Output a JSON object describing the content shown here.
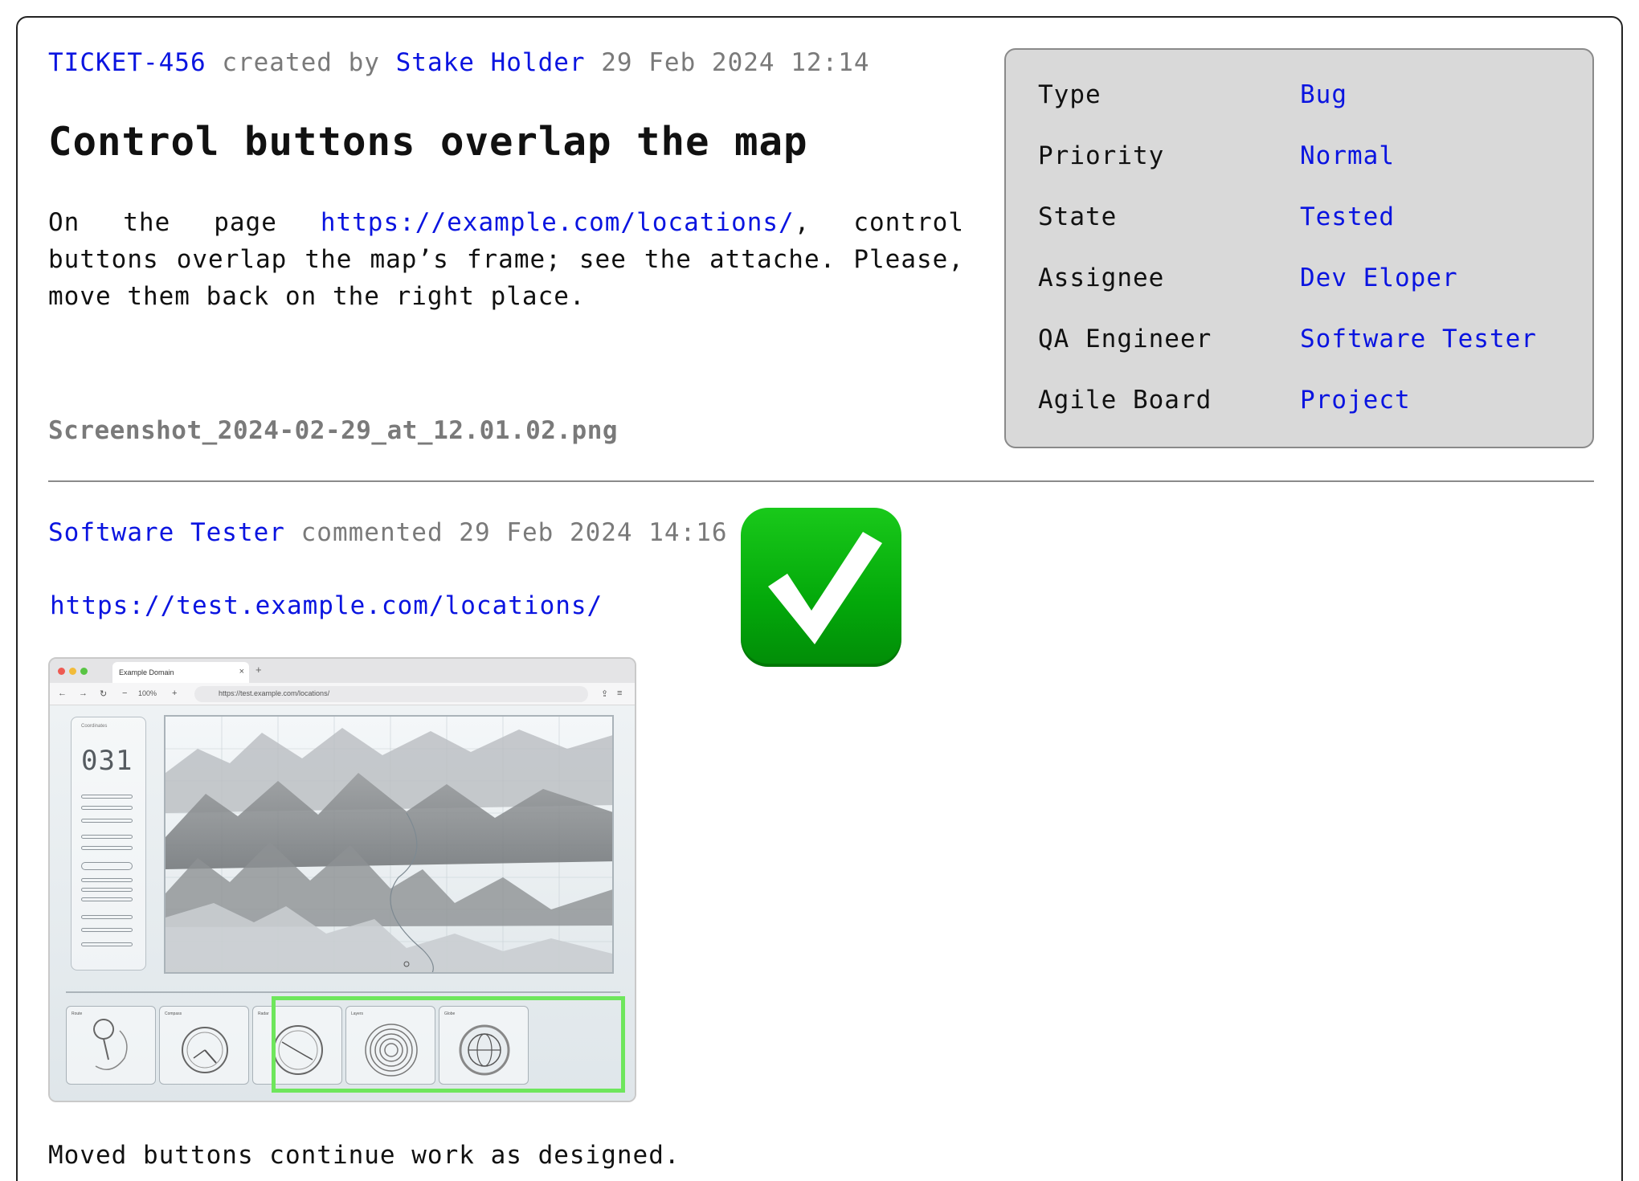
{
  "ticket": {
    "id": "TICKET-456",
    "created_by_text": "created by",
    "author": "Stake Holder",
    "created_at": "29 Feb 2024 12:14",
    "title": "Control buttons overlap the map",
    "description_prefix": "On the page ",
    "description_link": "https://example.com/locations/",
    "description_suffix": ", control buttons overlap the map’s frame; see the attache. Please, move them back on the right place.",
    "attachment": "Screenshot_2024-02-29_at_12.01.02.png"
  },
  "properties": [
    {
      "label": "Type",
      "value": "Bug"
    },
    {
      "label": "Priority",
      "value": "Normal"
    },
    {
      "label": "State",
      "value": "Tested"
    },
    {
      "label": "Assignee",
      "value": "Dev Eloper"
    },
    {
      "label": "QA Engineer",
      "value": "Software Tester"
    },
    {
      "label": "Agile Board",
      "value": "Project"
    }
  ],
  "comment": {
    "author": "Software Tester",
    "action_text": "commented",
    "created_at": "29 Feb 2024 14:16",
    "link": "https://test.example.com/locations/",
    "status_icon": "check-mark-button-icon",
    "text": "Moved buttons continue work as designed."
  },
  "embedded_screenshot": {
    "tab_title": "Example Domain",
    "tab_close": "×",
    "new_tab": "+",
    "zoom": "100%",
    "zoom_minus": "−",
    "zoom_plus": "+",
    "url": "https://test.example.com/locations/",
    "sidebar_caption": "Coordinates",
    "sidebar_number": "031",
    "button_labels": [
      "Route",
      "Compass",
      "Radar",
      "Layers",
      "Globe"
    ]
  },
  "colors": {
    "link": "#0a14e0",
    "muted": "#7a7a7a",
    "panel_bg": "#d9d9d9",
    "check_green": "#03a80a",
    "highlight_green": "#6ee65c"
  }
}
